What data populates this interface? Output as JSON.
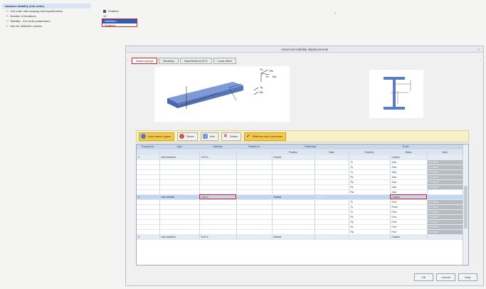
{
  "tree": {
    "header": "Advance stability (2nd order)",
    "rows": [
      {
        "label": "2nd order with swaying and imperfections",
        "value": "Enabled"
      },
      {
        "label": "Number of iterations",
        "value": "10"
      },
      {
        "label": "Stability - 2nd order parameters",
        "value": "Definition"
      },
      {
        "label": "Use for deflection checks",
        "value": "Disabled"
      }
    ]
  },
  "dialog": {
    "title": "Advanced stability displacements",
    "close": "×",
    "tabs": [
      "Nodal springs",
      "Buckling",
      "Imperfections EC3",
      "Local offset"
    ],
    "toolbar": {
      "autodetect": "Auto-detect spans",
      "reset": "Reset",
      "add": "Add",
      "delete": "Delete",
      "stiffness": "Stiffness auto-correction"
    },
    "beam_labels": {
      "tx": "Tx",
      "ty": "Ty",
      "tz": "Tz",
      "rx": "Rx",
      "ry": "Ry",
      "rz": "Rz"
    },
    "grid": {
      "columns": [
        "Property Nr.",
        "Type",
        "Absolute",
        "Relative to",
        "Positioning",
        "",
        "Di.Ma",
        "",
        ""
      ],
      "subcolumns": [
        "",
        "",
        "",
        "",
        "Position",
        "Value",
        "Direction",
        "Status",
        "Value"
      ],
      "rows": [
        {
          "kind": "prop",
          "c": [
            "1",
            "Auto detected",
            "0.00 m",
            "",
            "Neutral",
            "0.00 cm",
            "",
            "Custom",
            ""
          ]
        },
        {
          "kind": "",
          "c": [
            "",
            "",
            "",
            "",
            "",
            "",
            "Tx",
            "Auto",
            "0.0 kN/m"
          ]
        },
        {
          "kind": "",
          "c": [
            "",
            "",
            "",
            "",
            "",
            "",
            "Ty",
            "Auto",
            "0.0 kN/m"
          ]
        },
        {
          "kind": "",
          "c": [
            "",
            "",
            "",
            "",
            "",
            "",
            "Tz",
            "Auto",
            "0.0 kN/m"
          ]
        },
        {
          "kind": "",
          "c": [
            "",
            "",
            "",
            "",
            "",
            "",
            "Rx",
            "Auto",
            "0.0 kNm/°"
          ]
        },
        {
          "kind": "",
          "c": [
            "",
            "",
            "",
            "",
            "",
            "",
            "Ry",
            "Auto",
            "0.0 kNm/°"
          ]
        },
        {
          "kind": "",
          "c": [
            "",
            "",
            "",
            "",
            "",
            "",
            "Rz",
            "Auto",
            "0.0 kNm/°"
          ]
        },
        {
          "kind": "",
          "c": [
            "",
            "",
            "",
            "",
            "",
            "",
            "Rw",
            "Auto",
            ""
          ]
        },
        {
          "kind": "sel",
          "c": [
            "2",
            "User defined",
            "1.60 m",
            "",
            "Neutral",
            "0.00 cm",
            "",
            "Custom",
            ""
          ]
        },
        {
          "kind": "",
          "c": [
            "",
            "",
            "",
            "",
            "",
            "",
            "Tx",
            "Free",
            "0.0 kN/m"
          ]
        },
        {
          "kind": "",
          "c": [
            "",
            "",
            "",
            "",
            "",
            "",
            "Ty",
            "Fixed",
            "0.0 kN/m"
          ]
        },
        {
          "kind": "",
          "c": [
            "",
            "",
            "",
            "",
            "",
            "",
            "Tz",
            "Free",
            "0.0 kN/m"
          ]
        },
        {
          "kind": "",
          "c": [
            "",
            "",
            "",
            "",
            "",
            "",
            "Rx",
            "Free",
            "0.0 kNm/°"
          ]
        },
        {
          "kind": "",
          "c": [
            "",
            "",
            "",
            "",
            "",
            "",
            "Ry",
            "Free",
            "0.0 kNm/°"
          ]
        },
        {
          "kind": "",
          "c": [
            "",
            "",
            "",
            "",
            "",
            "",
            "Rz",
            "Free",
            "0.0 kNm/°"
          ]
        },
        {
          "kind": "",
          "c": [
            "",
            "",
            "",
            "",
            "",
            "",
            "Rw",
            "Free",
            "0.0 kNm/°"
          ]
        },
        {
          "kind": "prop",
          "c": [
            "3",
            "Auto detected",
            "6.40 m",
            "",
            "Neutral",
            "0.00 cm",
            "",
            "Custom",
            ""
          ]
        }
      ]
    },
    "buttons": {
      "ok": "OK",
      "cancel": "Cancel",
      "help": "Help"
    },
    "colors": {
      "accent": "#2b5cb8",
      "highlight": "#e02020",
      "toolbar": "#f8f0c8"
    }
  }
}
